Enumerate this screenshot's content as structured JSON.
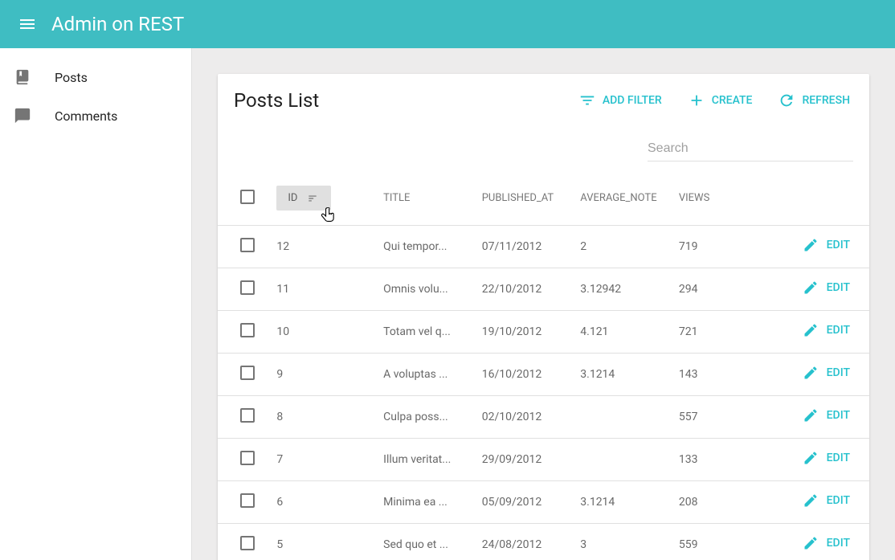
{
  "header": {
    "app_title": "Admin on REST"
  },
  "sidebar": {
    "items": [
      {
        "label": "Posts",
        "icon": "book"
      },
      {
        "label": "Comments",
        "icon": "message"
      }
    ]
  },
  "card": {
    "title": "Posts List",
    "actions": {
      "add_filter": "ADD FILTER",
      "create": "CREATE",
      "refresh": "REFRESH"
    }
  },
  "search": {
    "placeholder": "Search",
    "value": ""
  },
  "table": {
    "columns": {
      "id": "ID",
      "title": "TITLE",
      "published_at": "PUBLISHED_AT",
      "average_note": "AVERAGE_NOTE",
      "views": "VIEWS"
    },
    "sort": {
      "by": "id",
      "dir": "desc"
    },
    "edit_label": "EDIT",
    "rows": [
      {
        "id": "12",
        "title": "Qui tempor...",
        "published_at": "07/11/2012",
        "average_note": "2",
        "views": "719"
      },
      {
        "id": "11",
        "title": "Omnis volu...",
        "published_at": "22/10/2012",
        "average_note": "3.12942",
        "views": "294"
      },
      {
        "id": "10",
        "title": "Totam vel q...",
        "published_at": "19/10/2012",
        "average_note": "4.121",
        "views": "721"
      },
      {
        "id": "9",
        "title": "A voluptas ...",
        "published_at": "16/10/2012",
        "average_note": "3.1214",
        "views": "143"
      },
      {
        "id": "8",
        "title": "Culpa poss...",
        "published_at": "02/10/2012",
        "average_note": "",
        "views": "557"
      },
      {
        "id": "7",
        "title": "Illum veritat...",
        "published_at": "29/09/2012",
        "average_note": "",
        "views": "133"
      },
      {
        "id": "6",
        "title": "Minima ea ...",
        "published_at": "05/09/2012",
        "average_note": "3.1214",
        "views": "208"
      },
      {
        "id": "5",
        "title": "Sed quo et ...",
        "published_at": "24/08/2012",
        "average_note": "3",
        "views": "559"
      }
    ]
  },
  "colors": {
    "primary": "#3fbdc2",
    "accent": "#26c1cd"
  }
}
